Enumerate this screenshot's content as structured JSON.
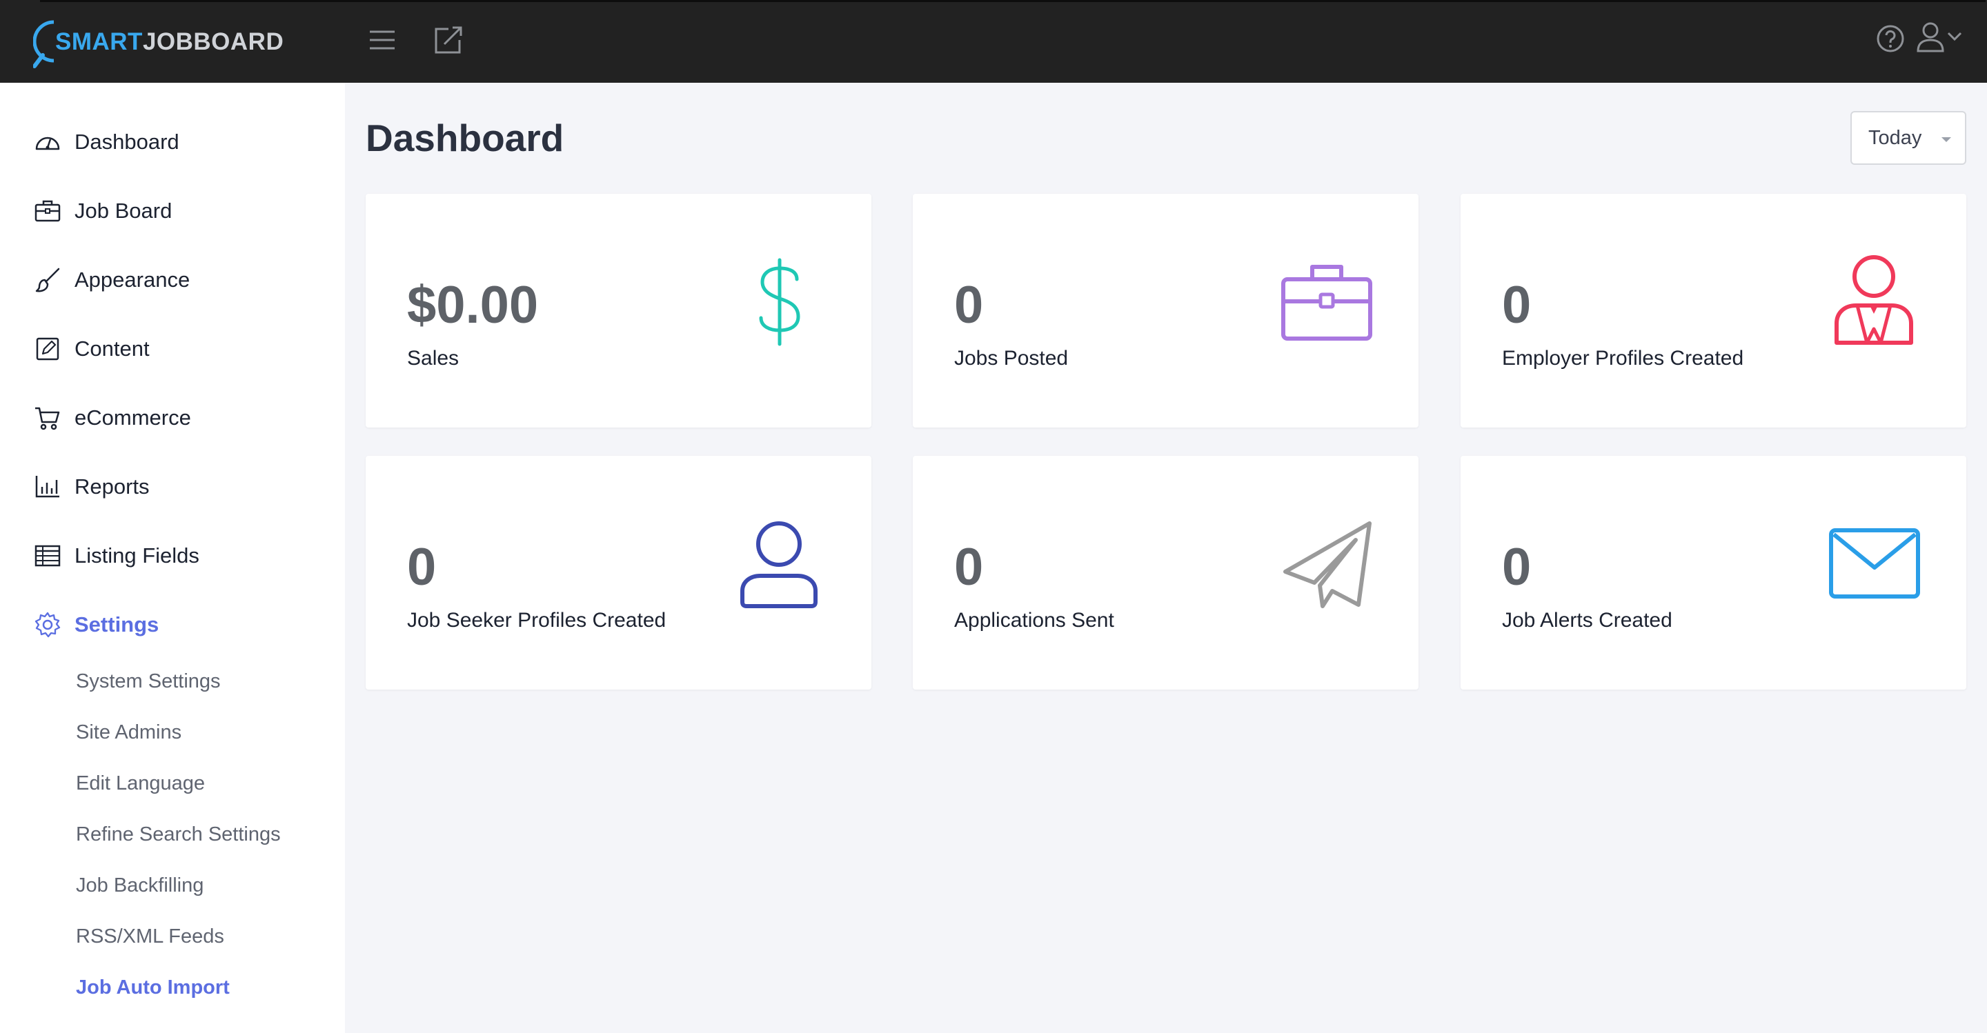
{
  "app": {
    "logo_part1": "SMART",
    "logo_part2": "JOBBOARD"
  },
  "topbar": {
    "icons": [
      "hamburger-menu-icon",
      "external-link-icon",
      "help-icon",
      "user-menu-icon"
    ]
  },
  "sidebar": {
    "items": [
      {
        "label": "Dashboard",
        "icon": "speedometer-icon"
      },
      {
        "label": "Job Board",
        "icon": "briefcase-icon"
      },
      {
        "label": "Appearance",
        "icon": "paintbrush-icon"
      },
      {
        "label": "Content",
        "icon": "edit-square-icon"
      },
      {
        "label": "eCommerce",
        "icon": "cart-icon"
      },
      {
        "label": "Reports",
        "icon": "bar-chart-icon"
      },
      {
        "label": "Listing Fields",
        "icon": "table-icon"
      },
      {
        "label": "Settings",
        "icon": "gear-icon",
        "active": true
      }
    ],
    "settings_subitems": [
      {
        "label": "System Settings"
      },
      {
        "label": "Site Admins"
      },
      {
        "label": "Edit Language"
      },
      {
        "label": "Refine Search Settings"
      },
      {
        "label": "Job Backfilling"
      },
      {
        "label": "RSS/XML Feeds"
      },
      {
        "label": "Job Auto Import",
        "active": true
      }
    ]
  },
  "main": {
    "title": "Dashboard",
    "period": "Today",
    "cards": [
      {
        "value": "$0.00",
        "caption": "Sales",
        "icon": "dollar-icon",
        "color": "#1fc8b4"
      },
      {
        "value": "0",
        "caption": "Jobs Posted",
        "icon": "briefcase-icon",
        "color": "#a978e0"
      },
      {
        "value": "0",
        "caption": "Employer Profiles Created",
        "icon": "employer-icon",
        "color": "#f0395a"
      },
      {
        "value": "0",
        "caption": "Job Seeker Profiles Created",
        "icon": "user-icon",
        "color": "#3b4ab0"
      },
      {
        "value": "0",
        "caption": "Applications Sent",
        "icon": "paper-plane-icon",
        "color": "#9a9a9a"
      },
      {
        "value": "0",
        "caption": "Job Alerts Created",
        "icon": "envelope-icon",
        "color": "#2a9ee8"
      }
    ]
  },
  "colors": {
    "topbar": "#222222",
    "accent": "#5b6ee1",
    "background": "#f4f5f9"
  }
}
